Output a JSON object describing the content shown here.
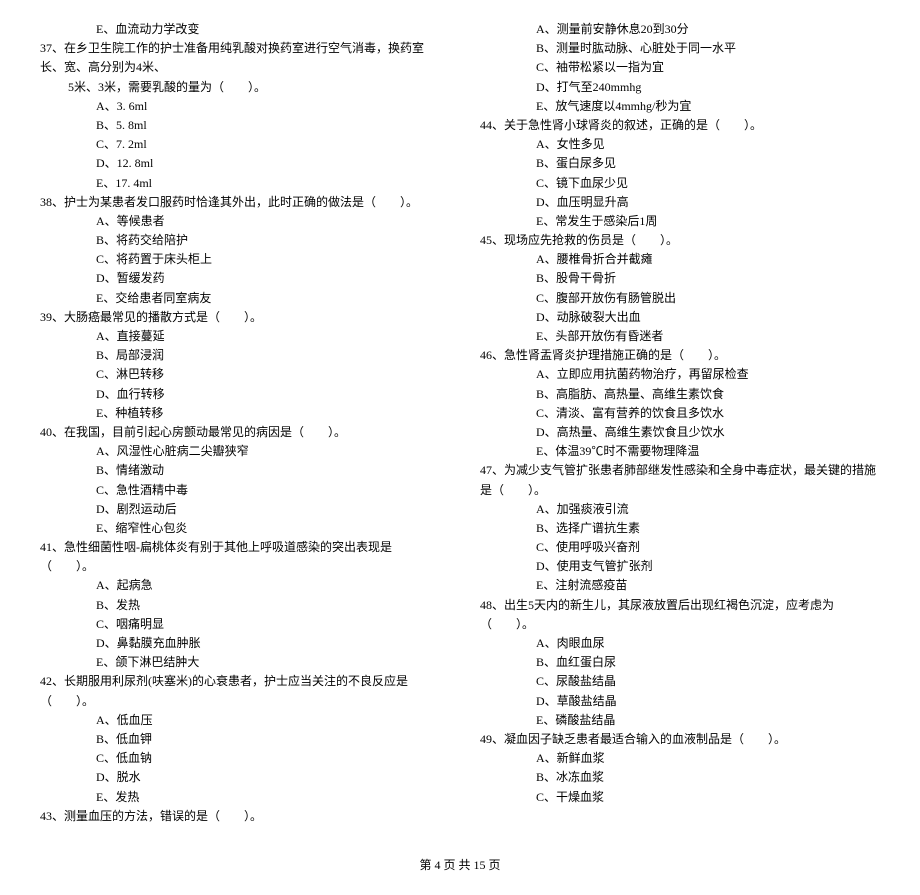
{
  "left": {
    "opt36e": "E、血流动力学改变",
    "q37": "37、在乡卫生院工作的护士准备用纯乳酸对换药室进行空气消毒，换药室长、宽、高分别为4米、",
    "q37_cont": "5米、3米，需要乳酸的量为（　　）。",
    "q37a": "A、3. 6ml",
    "q37b": "B、5. 8ml",
    "q37c": "C、7. 2ml",
    "q37d": "D、12. 8ml",
    "q37e": "E、17. 4ml",
    "q38": "38、护士为某患者发口服药时恰逢其外出，此时正确的做法是（　　）。",
    "q38a": "A、等候患者",
    "q38b": "B、将药交给陪护",
    "q38c": "C、将药置于床头柜上",
    "q38d": "D、暂缓发药",
    "q38e": "E、交给患者同室病友",
    "q39": "39、大肠癌最常见的播散方式是（　　）。",
    "q39a": "A、直接蔓延",
    "q39b": "B、局部浸润",
    "q39c": "C、淋巴转移",
    "q39d": "D、血行转移",
    "q39e": "E、种植转移",
    "q40": "40、在我国，目前引起心房颤动最常见的病因是（　　）。",
    "q40a": "A、风湿性心脏病二尖瓣狭窄",
    "q40b": "B、情绪激动",
    "q40c": "C、急性酒精中毒",
    "q40d": "D、剧烈运动后",
    "q40e": "E、缩窄性心包炎",
    "q41": "41、急性细菌性咽-扁桃体炎有别于其他上呼吸道感染的突出表现是（　　）。",
    "q41a": "A、起病急",
    "q41b": "B、发热",
    "q41c": "C、咽痛明显",
    "q41d": "D、鼻黏膜充血肿胀",
    "q41e": "E、颌下淋巴结肿大",
    "q42": "42、长期服用利尿剂(呋塞米)的心衰患者，护士应当关注的不良反应是（　　）。",
    "q42a": "A、低血压",
    "q42b": "B、低血钾",
    "q42c": "C、低血钠",
    "q42d": "D、脱水",
    "q42e": "E、发热",
    "q43": "43、测量血压的方法，错误的是（　　）。"
  },
  "right": {
    "q43a": "A、测量前安静休息20到30分",
    "q43b": "B、测量时肱动脉、心脏处于同一水平",
    "q43c": "C、袖带松紧以一指为宜",
    "q43d": "D、打气至240mmhg",
    "q43e": "E、放气速度以4mmhg/秒为宜",
    "q44": "44、关于急性肾小球肾炎的叙述，正确的是（　　）。",
    "q44a": "A、女性多见",
    "q44b": "B、蛋白尿多见",
    "q44c": "C、镜下血尿少见",
    "q44d": "D、血压明显升高",
    "q44e": "E、常发生于感染后1周",
    "q45": "45、现场应先抢救的伤员是（　　）。",
    "q45a": "A、腰椎骨折合并截瘫",
    "q45b": "B、股骨干骨折",
    "q45c": "C、腹部开放伤有肠管脱出",
    "q45d": "D、动脉破裂大出血",
    "q45e": "E、头部开放伤有昏迷者",
    "q46": "46、急性肾盂肾炎护理措施正确的是（　　）。",
    "q46a": "A、立即应用抗菌药物治疗，再留尿检查",
    "q46b": "B、高脂肪、高热量、高维生素饮食",
    "q46c": "C、清淡、富有营养的饮食且多饮水",
    "q46d": "D、高热量、高维生素饮食且少饮水",
    "q46e": "E、体温39℃时不需要物理降温",
    "q47": "47、为减少支气管扩张患者肺部继发性感染和全身中毒症状，最关键的措施是（　　）。",
    "q47a": "A、加强痰液引流",
    "q47b": "B、选择广谱抗生素",
    "q47c": "C、使用呼吸兴奋剂",
    "q47d": "D、使用支气管扩张剂",
    "q47e": "E、注射流感疫苗",
    "q48": "48、出生5天内的新生儿，其尿液放置后出现红褐色沉淀，应考虑为（　　）。",
    "q48a": "A、肉眼血尿",
    "q48b": "B、血红蛋白尿",
    "q48c": "C、尿酸盐结晶",
    "q48d": "D、草酸盐结晶",
    "q48e": "E、磷酸盐结晶",
    "q49": "49、凝血因子缺乏患者最适合输入的血液制品是（　　）。",
    "q49a": "A、新鲜血浆",
    "q49b": "B、冰冻血浆",
    "q49c": "C、干燥血浆"
  },
  "footer": "第 4 页 共 15 页"
}
